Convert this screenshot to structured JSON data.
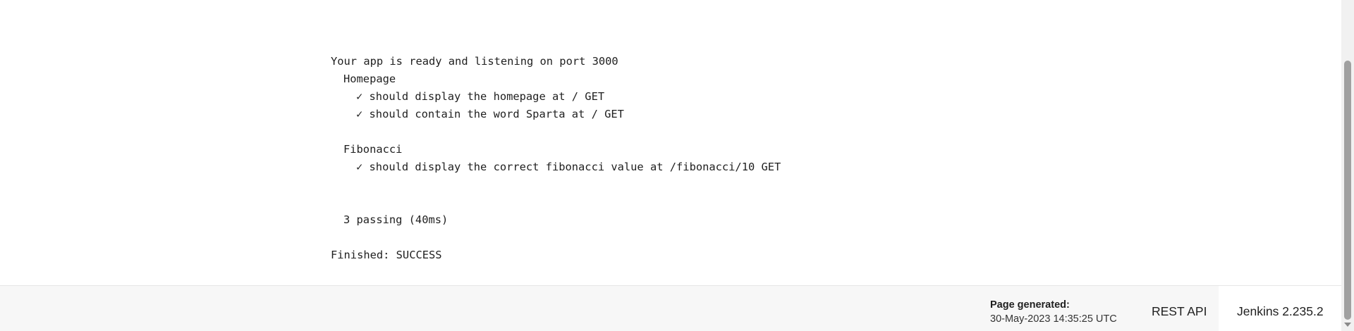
{
  "console": {
    "lines": [
      "Your app is ready and listening on port 3000",
      "Homepage",
      "✓ should display the homepage at / GET",
      "✓ should contain the word Sparta at / GET",
      "",
      "Fibonacci",
      "✓ should display the correct fibonacci value at /fibonacci/10 GET",
      "",
      "",
      "3 passing (40ms)",
      "",
      "Finished: SUCCESS"
    ]
  },
  "footer": {
    "page_generated_label": "Page generated:",
    "page_generated_time": "30-May-2023 14:35:25 UTC",
    "rest_api_label": "REST API",
    "version_label": "Jenkins 2.235.2"
  }
}
